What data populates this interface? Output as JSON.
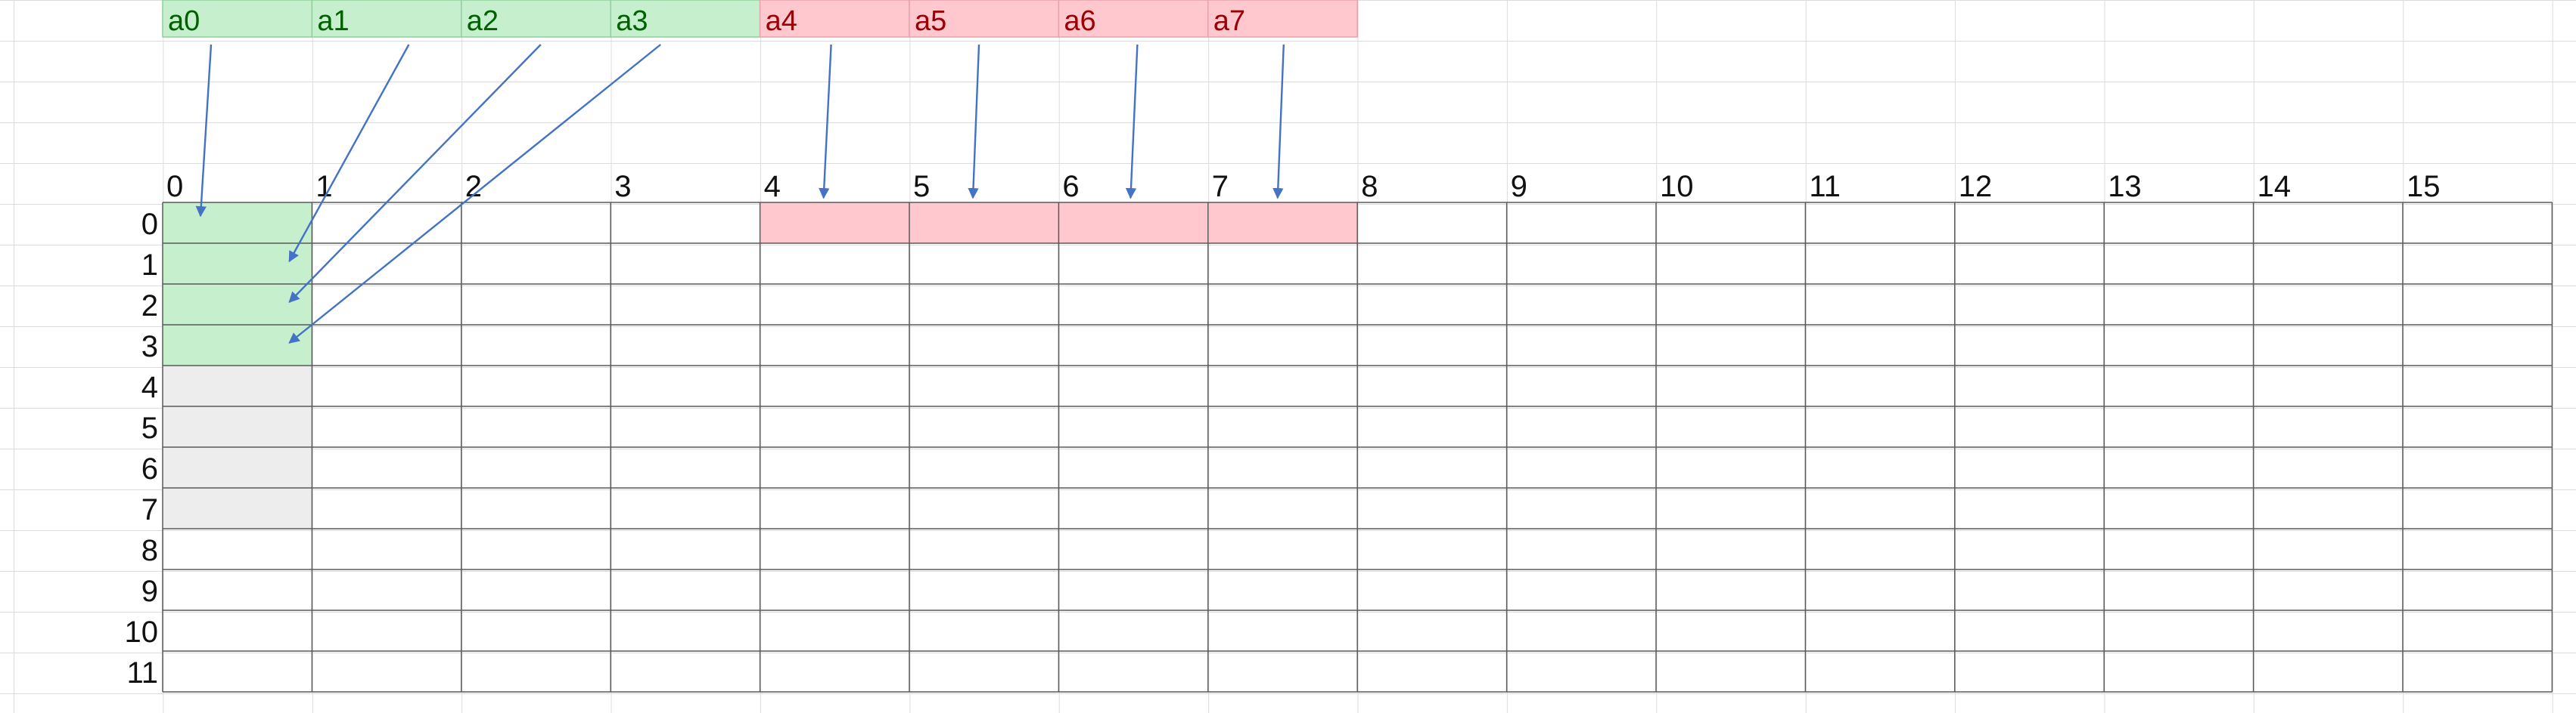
{
  "top_row": {
    "cells": [
      {
        "label": "a0",
        "group": "green"
      },
      {
        "label": "a1",
        "group": "green"
      },
      {
        "label": "a2",
        "group": "green"
      },
      {
        "label": "a3",
        "group": "green"
      },
      {
        "label": "a4",
        "group": "red"
      },
      {
        "label": "a5",
        "group": "red"
      },
      {
        "label": "a6",
        "group": "red"
      },
      {
        "label": "a7",
        "group": "red"
      }
    ]
  },
  "grid": {
    "column_numbers": [
      "0",
      "1",
      "2",
      "3",
      "4",
      "5",
      "6",
      "7",
      "8",
      "9",
      "10",
      "11",
      "12",
      "13",
      "14",
      "15"
    ],
    "row_numbers": [
      "0",
      "1",
      "2",
      "3",
      "4",
      "5",
      "6",
      "7",
      "8",
      "9",
      "10",
      "11"
    ],
    "green_cells": [
      [
        0,
        0
      ],
      [
        1,
        0
      ],
      [
        2,
        0
      ],
      [
        3,
        0
      ]
    ],
    "gray_cells": [
      [
        4,
        0
      ],
      [
        5,
        0
      ],
      [
        6,
        0
      ],
      [
        7,
        0
      ]
    ],
    "red_cells": [
      [
        0,
        4
      ],
      [
        0,
        5
      ],
      [
        0,
        6
      ],
      [
        0,
        7
      ]
    ]
  },
  "arrows": [
    {
      "from": "a0",
      "to_cell": [
        0,
        0
      ]
    },
    {
      "from": "a1",
      "to_cell": [
        1,
        0
      ]
    },
    {
      "from": "a2",
      "to_cell": [
        2,
        0
      ]
    },
    {
      "from": "a3",
      "to_cell": [
        3,
        0
      ]
    },
    {
      "from": "a4",
      "to_column": 4
    },
    {
      "from": "a5",
      "to_column": 5
    },
    {
      "from": "a6",
      "to_column": 6
    },
    {
      "from": "a7",
      "to_column": 7
    }
  ],
  "colors": {
    "green_fill": "#c6efce",
    "green_text": "#006100",
    "red_fill": "#ffc7ce",
    "red_text": "#9c0006",
    "gray_fill": "#ededed",
    "arrow": "#4472c4",
    "grid_line": "#5a5a5a",
    "cell_line": "#2e2e2e"
  }
}
